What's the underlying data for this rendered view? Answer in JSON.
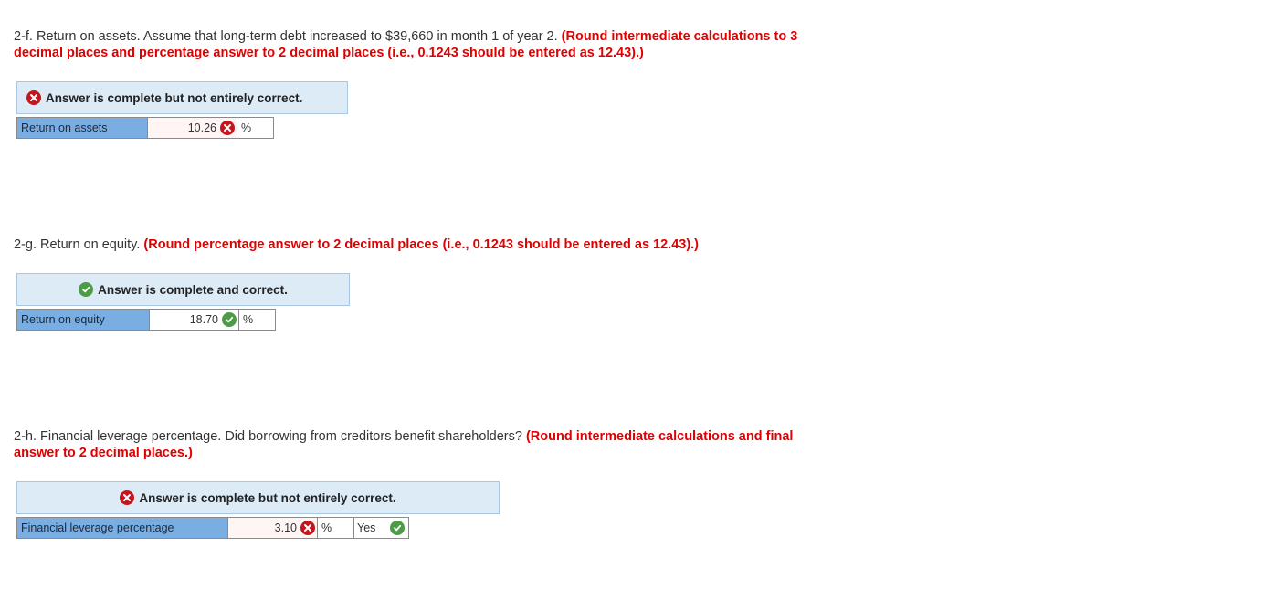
{
  "q2f": {
    "text": "2-f. Return on assets. Assume that long-term debt increased to $39,660 in month 1 of year 2.",
    "instruction_line1": "(Round intermediate calculations to 3",
    "instruction_line2": "decimal places and percentage answer to 2 decimal places (i.e., 0.1243 should be entered as 12.43).)",
    "banner": "Answer is complete but not entirely correct.",
    "row_label": "Return on assets",
    "value": "10.26",
    "unit": "%"
  },
  "q2g": {
    "text": "2-g. Return on equity.",
    "instruction": "(Round percentage answer to 2 decimal places (i.e., 0.1243 should be entered as 12.43).)",
    "banner": "Answer is complete and correct.",
    "row_label": "Return on equity",
    "value": "18.70",
    "unit": "%"
  },
  "q2h": {
    "text": "2-h. Financial leverage percentage. Did borrowing from creditors benefit shareholders?",
    "instruction_line1": "(Round intermediate calculations and final",
    "instruction_line2": "answer to 2 decimal places.)",
    "banner": "Answer is complete but not entirely correct.",
    "row_label": "Financial leverage percentage",
    "value": "3.10",
    "unit": "%",
    "selection": "Yes"
  },
  "colors": {
    "incorrect": "#c4161c",
    "correct": "#4b9c44",
    "instruction": "#e00000",
    "banner_bg": "#ddebf7",
    "label_bg": "#7aaee3"
  }
}
